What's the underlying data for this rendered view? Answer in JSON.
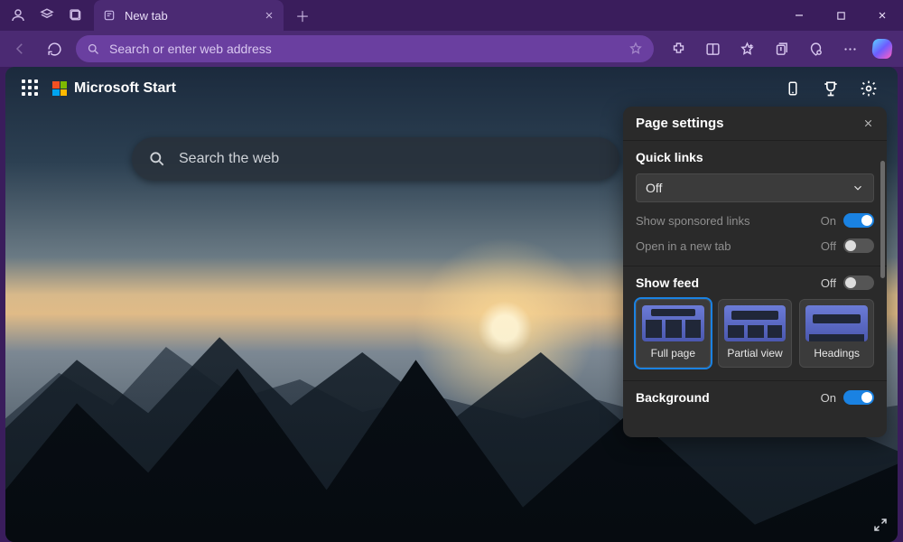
{
  "window": {
    "tab_title": "New tab"
  },
  "toolbar": {
    "address_placeholder": "Search or enter web address"
  },
  "page": {
    "brand": "Microsoft Start",
    "search_placeholder": "Search the web"
  },
  "panel": {
    "title": "Page settings",
    "quicklinks": {
      "title": "Quick links",
      "value": "Off",
      "sponsored": {
        "label": "Show sponsored links",
        "state": "On"
      },
      "newtab": {
        "label": "Open in a new tab",
        "state": "Off"
      }
    },
    "feed": {
      "title": "Show feed",
      "state": "Off",
      "options": {
        "full": "Full page",
        "partial": "Partial view",
        "head": "Headings"
      }
    },
    "background": {
      "title": "Background",
      "state": "On"
    }
  }
}
